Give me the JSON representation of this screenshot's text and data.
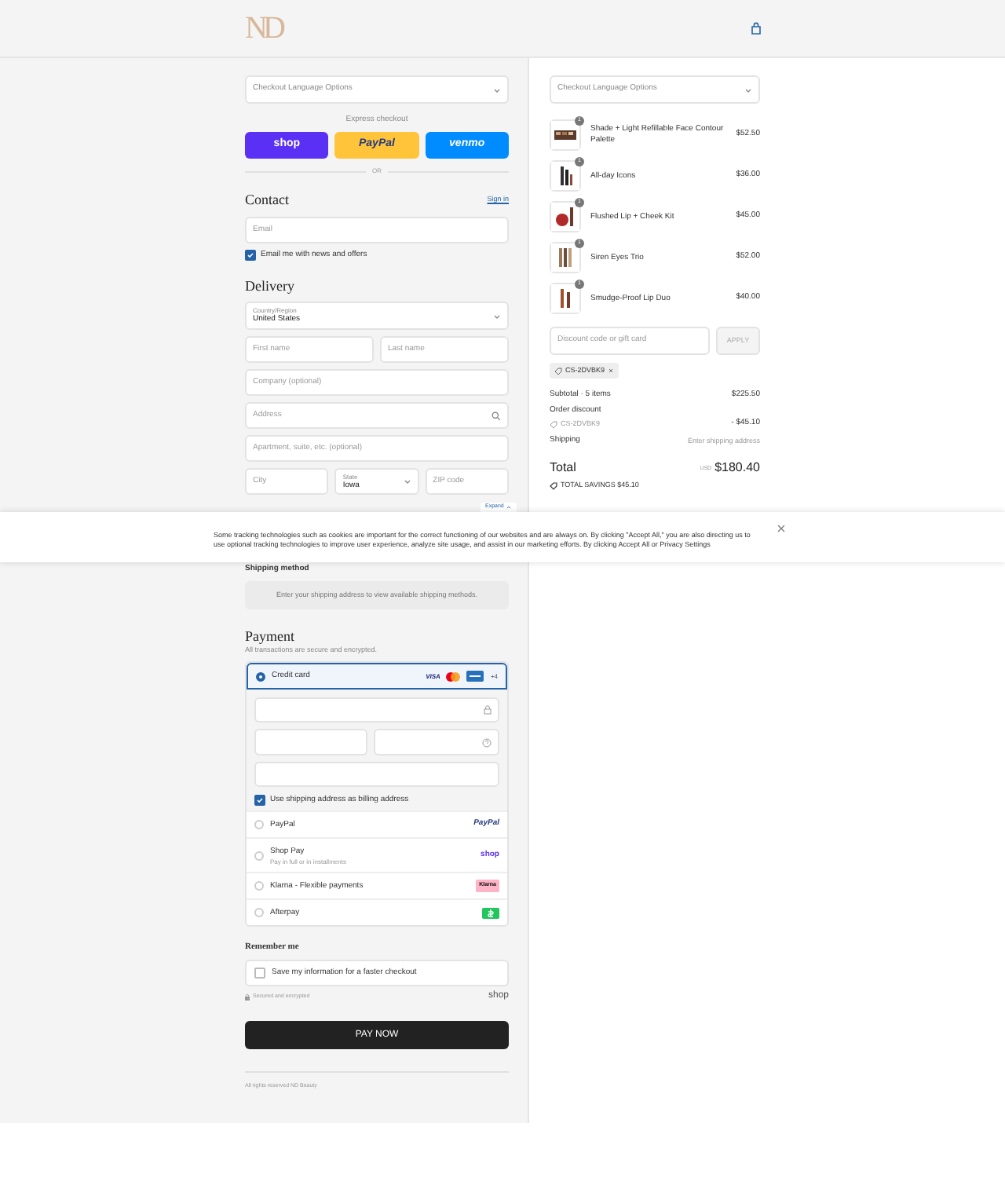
{
  "header": {
    "logo": "ND"
  },
  "checkout": {
    "language_select": {
      "placeholder": "Checkout Language Options"
    },
    "express": {
      "label": "Express checkout",
      "buttons": [
        {
          "kind": "shop",
          "label": "shop"
        },
        {
          "kind": "paypal",
          "label": "PayPal"
        },
        {
          "kind": "venmo",
          "label": "venmo"
        }
      ],
      "divider": "OR"
    },
    "contact": {
      "title": "Contact",
      "link": "Sign in",
      "email": {
        "placeholder": "Email"
      },
      "news": {
        "label": "Email me with news and offers",
        "checked": true
      }
    },
    "delivery": {
      "title": "Delivery",
      "rows": [
        [
          {
            "kind": "select",
            "label": "Country/Region",
            "value": "United States"
          }
        ],
        [
          {
            "kind": "text",
            "placeholder": "First name"
          },
          {
            "kind": "text",
            "placeholder": "Last name"
          }
        ],
        [
          {
            "kind": "text",
            "placeholder": "Company (optional)"
          }
        ],
        [
          {
            "kind": "search",
            "placeholder": "Address"
          }
        ],
        [
          {
            "kind": "text",
            "placeholder": "Apartment, suite, etc. (optional)"
          }
        ],
        [
          {
            "kind": "text",
            "placeholder": "City"
          },
          {
            "kind": "select",
            "label": "State",
            "value": "Iowa"
          },
          {
            "kind": "text",
            "placeholder": "ZIP code"
          }
        ]
      ]
    },
    "shipping": {
      "title": "Shipping method",
      "notice": "Enter your shipping address to view available shipping methods."
    },
    "payment": {
      "title": "Payment",
      "subtitle": "All transactions are secure and encrypted.",
      "methods": [
        {
          "kind": "card",
          "label": "Credit card",
          "selected": true,
          "visa": "VISA",
          "more": "+4"
        },
        {
          "kind": "paypal",
          "label": "PayPal",
          "selected": false,
          "logo": "PayPal"
        },
        {
          "kind": "shoppay",
          "label": "Shop Pay",
          "sub": "Pay in full or in installments",
          "selected": false,
          "logo": "shop"
        },
        {
          "kind": "klarna",
          "label": "Klarna - Flexible payments",
          "selected": false,
          "logo": "Klarna"
        },
        {
          "kind": "afterpay",
          "label": "Afterpay",
          "selected": false
        }
      ],
      "billing": {
        "label": "Use shipping address as billing address",
        "checked": true
      }
    },
    "remember": {
      "title": "Remember me",
      "save": {
        "label": "Save my information for a faster checkout",
        "checked": false
      },
      "secure": "Secured and encrypted",
      "shop": "shop"
    },
    "pay_button": "PAY NOW",
    "footer": "All rights reserved ND Beauty"
  },
  "summary": {
    "language_select": {
      "placeholder": "Checkout Language Options"
    },
    "items": [
      {
        "name": "Shade + Light Refillable Face Contour Palette",
        "price": "$52.50",
        "quantity": "1"
      },
      {
        "name": "All-day Icons",
        "price": "$36.00",
        "quantity": "1"
      },
      {
        "name": "Flushed Lip + Cheek Kit",
        "price": "$45.00",
        "quantity": "1"
      },
      {
        "name": "Siren Eyes Trio",
        "price": "$52.00",
        "quantity": "1"
      },
      {
        "name": "Smudge-Proof Lip Duo",
        "price": "$40.00",
        "quantity": "1"
      }
    ],
    "discount": {
      "placeholder": "Discount code or gift card",
      "button": "APPLY"
    },
    "applied_code": "CS-2DVBK9",
    "subtotal": {
      "label": "Subtotal · 5 items",
      "value": "$225.50"
    },
    "order_discount": {
      "label": "Order discount",
      "code": "CS-2DVBK9",
      "value": "- $45.10"
    },
    "shipping": {
      "label": "Shipping",
      "value": "Enter shipping address"
    },
    "total": {
      "label": "Total",
      "currency": "USD",
      "value": "$180.40"
    },
    "savings": "TOTAL SAVINGS $45.10"
  },
  "cookie_banner": {
    "expand": "Expand",
    "text": "Some tracking technologies such as cookies are important for the correct functioning of our websites and are always on. By clicking \"Accept All,\" you are also directing us to use optional tracking technologies to improve user experience, analyze site usage, and assist in our marketing efforts. By clicking Accept All or Privacy Settings"
  }
}
